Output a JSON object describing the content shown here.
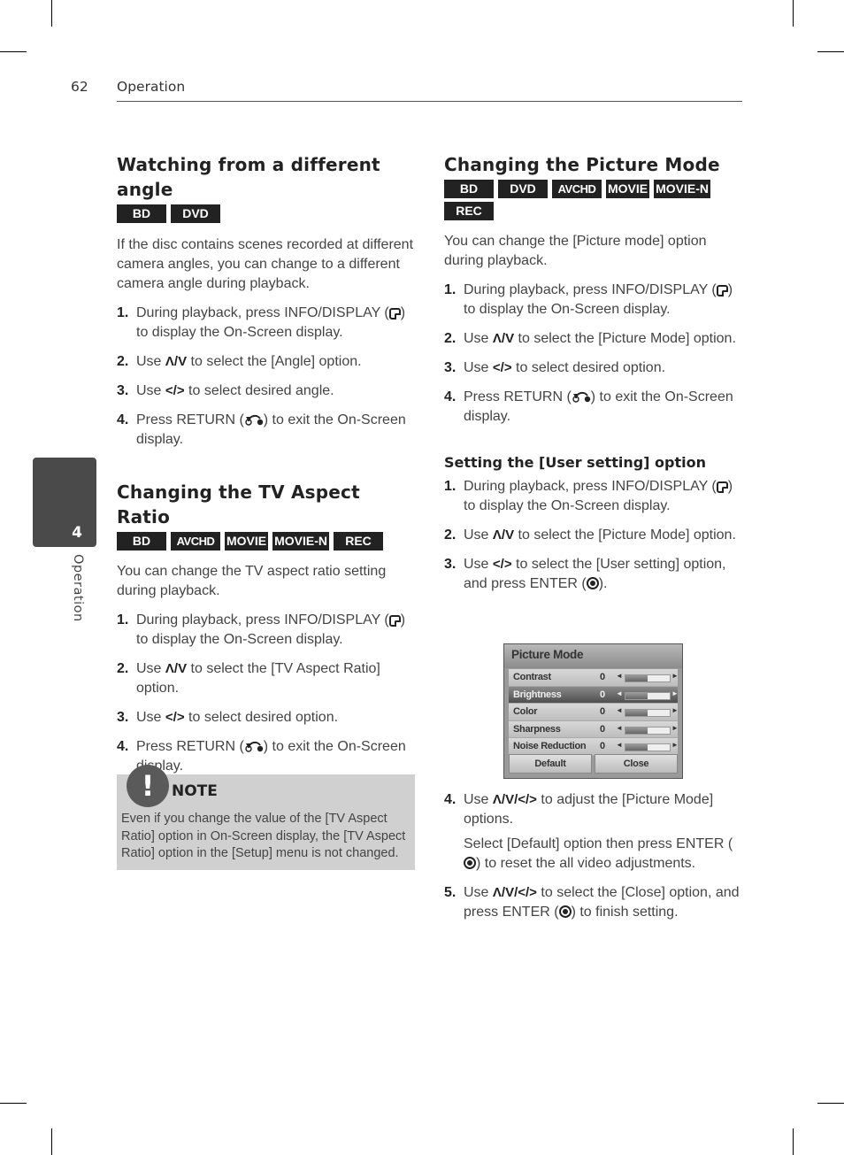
{
  "header": {
    "page_number": "62",
    "section": "Operation"
  },
  "side_tab": {
    "chapter_number": "4",
    "chapter_label": "Operation"
  },
  "left": {
    "angle": {
      "title": "Watching from a different angle",
      "badges": [
        "BD",
        "DVD"
      ],
      "intro": "If the disc contains scenes recorded at different camera angles, you can change to a different camera angle during playback.",
      "steps": [
        {
          "num": "1.",
          "pre": "During playback, press INFO/DISPLAY (",
          "icon": "info-display-icon",
          "post": ") to display the On-Screen display."
        },
        {
          "num": "2.",
          "pre": "Use ",
          "symbol": "Λ/V",
          "post": " to select the [Angle] option."
        },
        {
          "num": "3.",
          "pre": "Use ",
          "symbol": "</>",
          "post": " to select desired angle."
        },
        {
          "num": "4.",
          "pre": "Press RETURN (",
          "icon": "return-icon",
          "post": ") to exit the On-Screen display."
        }
      ]
    },
    "aspect": {
      "title": "Changing the TV Aspect Ratio",
      "badges": [
        "BD",
        "AVCHD",
        "MOVIE",
        "MOVIE-N",
        "REC"
      ],
      "intro": "You can change the TV aspect ratio setting during playback.",
      "steps": [
        {
          "num": "1.",
          "pre": "During playback, press INFO/DISPLAY (",
          "icon": "info-display-icon",
          "post": ") to display the On-Screen display."
        },
        {
          "num": "2.",
          "pre": "Use ",
          "symbol": "Λ/V",
          "post": " to select the [TV Aspect Ratio] option."
        },
        {
          "num": "3.",
          "pre": "Use ",
          "symbol": "</>",
          "post": " to select desired option."
        },
        {
          "num": "4.",
          "pre": "Press RETURN (",
          "icon": "return-icon",
          "post": ") to exit the On-Screen display."
        }
      ]
    },
    "note": {
      "icon": "!",
      "title": "NOTE",
      "body": "Even if you change the value of the [TV Aspect Ratio] option in On-Screen display, the [TV Aspect Ratio] option in the [Setup] menu is not changed."
    }
  },
  "right": {
    "picture": {
      "title": "Changing the Picture Mode",
      "badges": [
        "BD",
        "DVD",
        "AVCHD",
        "MOVIE",
        "MOVIE-N",
        "REC"
      ],
      "intro": "You can change the [Picture mode] option during playback.",
      "steps": [
        {
          "num": "1.",
          "pre": "During playback, press INFO/DISPLAY (",
          "icon": "info-display-icon",
          "post": ") to display the On-Screen display."
        },
        {
          "num": "2.",
          "pre": "Use ",
          "symbol": "Λ/V",
          "post": " to select the [Picture Mode] option."
        },
        {
          "num": "3.",
          "pre": "Use ",
          "symbol": "</>",
          "post": " to select desired option."
        },
        {
          "num": "4.",
          "pre": "Press RETURN (",
          "icon": "return-icon",
          "post": ") to exit the On-Screen display."
        }
      ]
    },
    "user_setting": {
      "title": "Setting the [User setting] option",
      "steps_a": [
        {
          "num": "1.",
          "pre": "During playback, press INFO/DISPLAY (",
          "icon": "info-display-icon",
          "post": ") to display the On-Screen display."
        },
        {
          "num": "2.",
          "pre": "Use ",
          "symbol": "Λ/V",
          "post": " to select the [Picture Mode] option."
        },
        {
          "num": "3.",
          "pre": "Use ",
          "symbol": "</>",
          "post": " to select the [User setting] option, and press ENTER (",
          "icon": "enter-icon",
          "post2": ")."
        }
      ],
      "osd": {
        "title": "Picture Mode",
        "rows": [
          {
            "label": "Contrast",
            "value": "0",
            "level": 0.5,
            "selected": false
          },
          {
            "label": "Brightness",
            "value": "0",
            "level": 0.5,
            "selected": true
          },
          {
            "label": "Color",
            "value": "0",
            "level": 0.5,
            "selected": false
          },
          {
            "label": "Sharpness",
            "value": "0",
            "level": 0.5,
            "selected": false
          },
          {
            "label": "Noise Reduction",
            "value": "0",
            "level": 0.5,
            "selected": false
          }
        ],
        "left_arrow": "◄",
        "right_arrow": "►",
        "buttons": [
          "Default",
          "Close"
        ]
      },
      "steps_b": [
        {
          "num": "4.",
          "pre": "Use ",
          "symbol": "Λ/V/</>",
          "post": " to adjust the [Picture Mode] options.",
          "sub_pre": "Select [Default] option then press ENTER (",
          "sub_icon": "enter-icon",
          "sub_post": ") to reset the all video adjustments."
        },
        {
          "num": "5.",
          "pre": "Use ",
          "symbol": "Λ/V/</>",
          "post": " to select the [Close] option, and press ENTER (",
          "icon": "enter-icon",
          "post2": ") to finish setting."
        }
      ]
    }
  }
}
